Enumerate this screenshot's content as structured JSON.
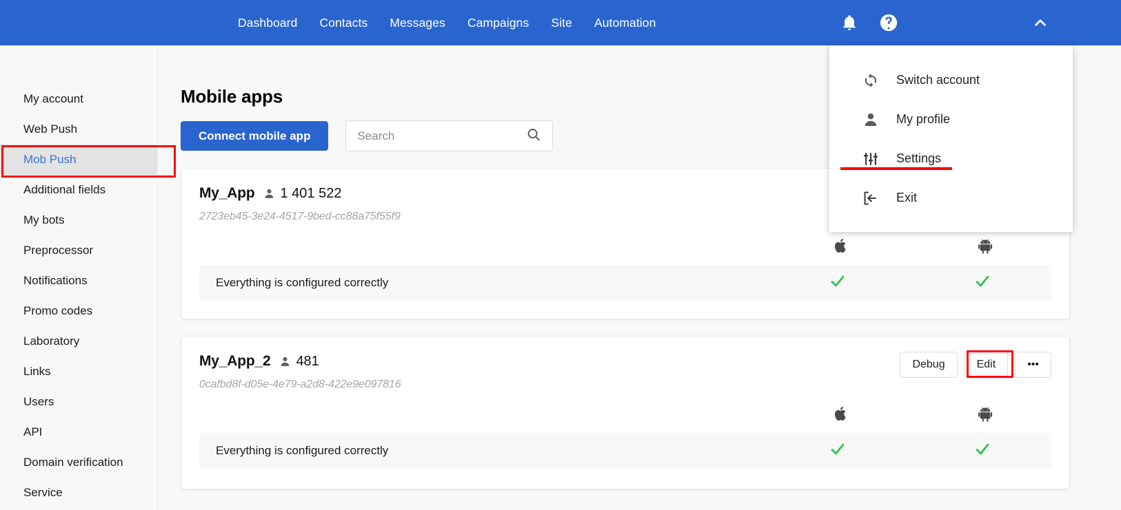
{
  "topbar": {
    "background": "#2a64ce",
    "nav": [
      {
        "label": "Dashboard"
      },
      {
        "label": "Contacts"
      },
      {
        "label": "Messages"
      },
      {
        "label": "Campaigns"
      },
      {
        "label": "Site"
      },
      {
        "label": "Automation"
      }
    ],
    "icons": {
      "bell": "notification-bell-icon",
      "help": "help-circle-icon",
      "chevron": "chevron-up-icon"
    }
  },
  "account_menu": {
    "items": [
      {
        "label": "Switch account",
        "icon": "switch-account-icon"
      },
      {
        "label": "My profile",
        "icon": "person-icon"
      },
      {
        "label": "Settings",
        "icon": "sliders-icon"
      },
      {
        "label": "Exit",
        "icon": "exit-icon"
      }
    ],
    "highlight_color": "#ff0000"
  },
  "sidebar": {
    "items": [
      {
        "label": "My account",
        "active": false
      },
      {
        "label": "Web Push",
        "active": false
      },
      {
        "label": "Mob Push",
        "active": true
      },
      {
        "label": "Additional fields",
        "active": false
      },
      {
        "label": "My bots",
        "active": false
      },
      {
        "label": "Preprocessor",
        "active": false
      },
      {
        "label": "Notifications",
        "active": false
      },
      {
        "label": "Promo codes",
        "active": false
      },
      {
        "label": "Laboratory",
        "active": false
      },
      {
        "label": "Links",
        "active": false
      },
      {
        "label": "Users",
        "active": false
      },
      {
        "label": "API",
        "active": false
      },
      {
        "label": "Domain verification",
        "active": false
      },
      {
        "label": "Service",
        "active": false
      }
    ],
    "active_text_color": "#3b72d9",
    "active_bg_color": "#e3e3e3"
  },
  "main": {
    "title": "Mobile apps",
    "connect_button": "Connect mobile app",
    "search": {
      "value": "",
      "placeholder": "Search",
      "icon": "search-icon"
    },
    "apps": [
      {
        "name": "My_App",
        "subscribers": "1 401 522",
        "uuid": "2723eb45-3e24-4517-9bed-cc88a75f55f9",
        "status": "Everything is configured correctly",
        "ios_ok": "✓",
        "android_ok": "✓",
        "actions": []
      },
      {
        "name": "My_App_2",
        "subscribers": "481",
        "uuid": "0cafbd8f-d05e-4e79-a2d8-422e9e097816",
        "status": "Everything is configured correctly",
        "ios_ok": "✓",
        "android_ok": "✓",
        "actions": [
          {
            "label": "Debug",
            "name": "debug-button",
            "highlighted": false
          },
          {
            "label": "Edit",
            "name": "edit-button",
            "highlighted": true
          },
          {
            "label": "•••",
            "name": "more-options-button",
            "highlighted": false
          }
        ]
      }
    ],
    "check_color": "#2ec04a"
  }
}
